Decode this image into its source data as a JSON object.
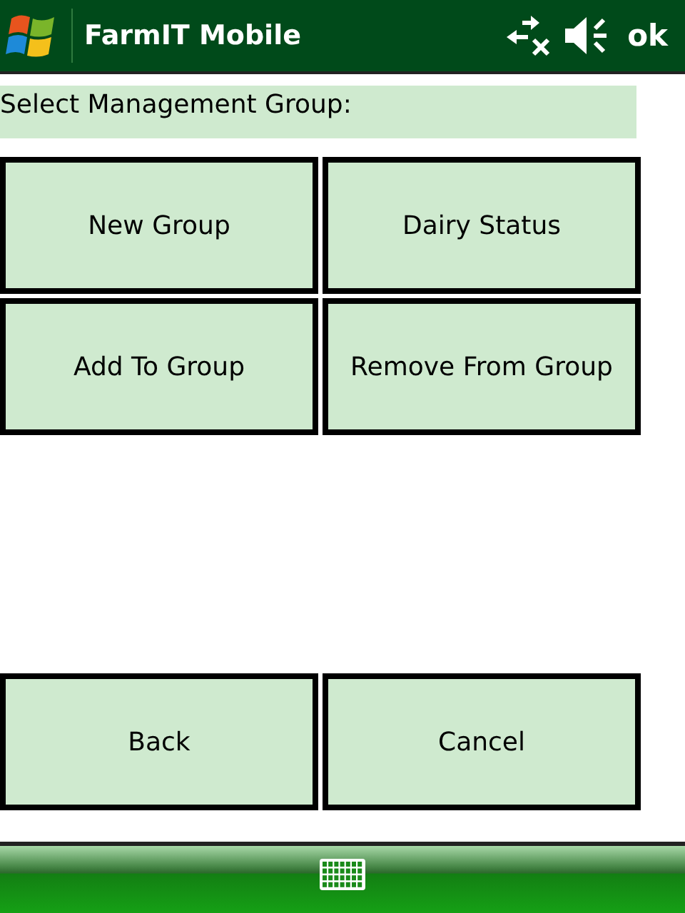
{
  "title_bar": {
    "title": "FarmIT Mobile",
    "ok": "ok"
  },
  "prompt": "Select Management Group:",
  "groups": [
    {
      "label": "New Group"
    },
    {
      "label": "Dairy Status"
    },
    {
      "label": "Add To Group"
    },
    {
      "label": "Remove From Group"
    }
  ],
  "actions": [
    {
      "label": "Back"
    },
    {
      "label": "Cancel"
    }
  ]
}
